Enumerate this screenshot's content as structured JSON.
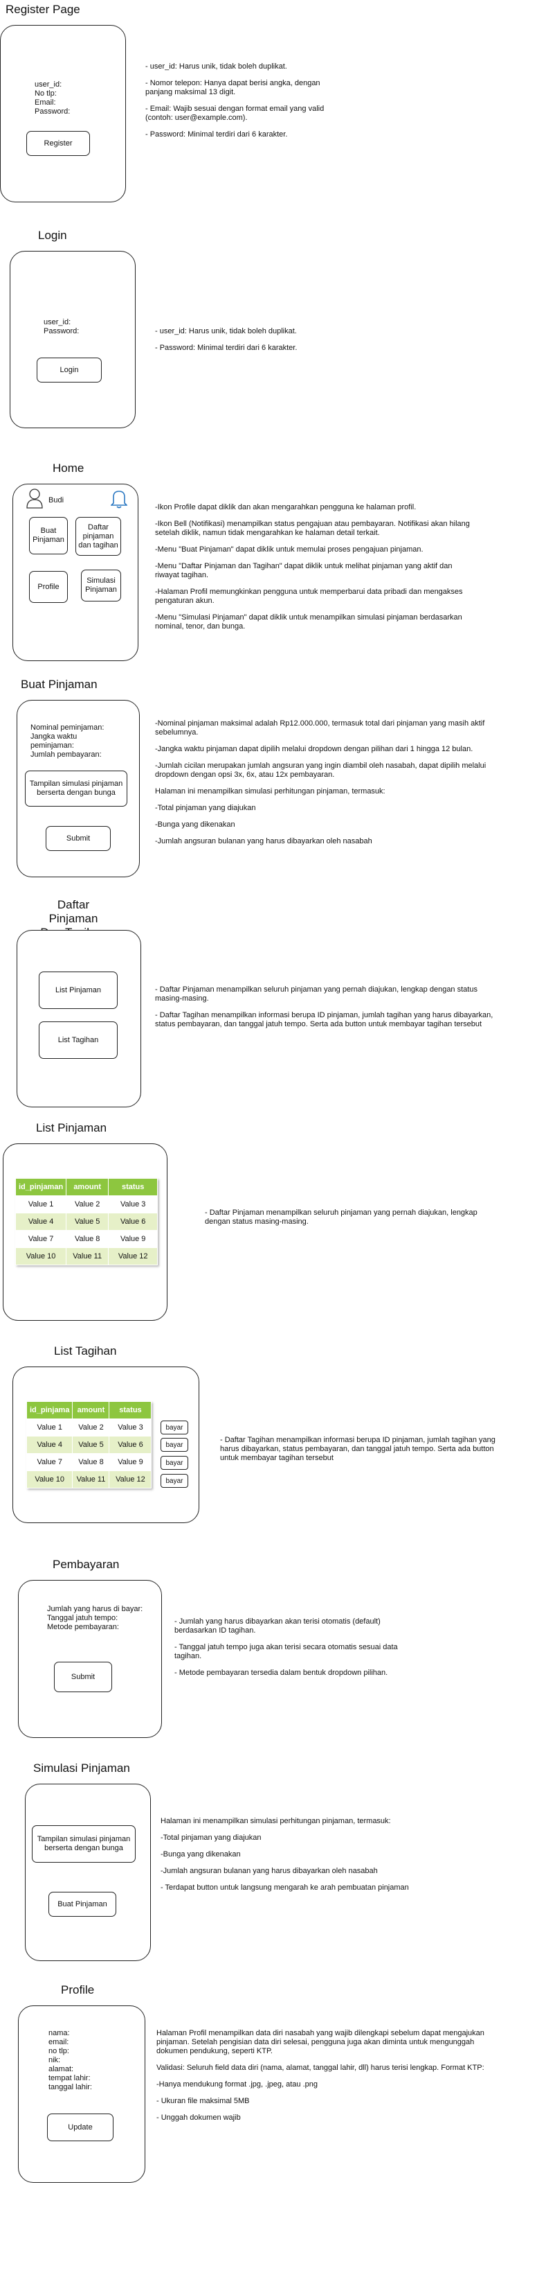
{
  "register": {
    "title": "Register Page",
    "fields": "user_id:\nNo tlp:\nEmail:\nPassword:",
    "button": "Register",
    "notes": [
      "- user_id: Harus unik, tidak boleh duplikat.",
      "- Nomor telepon: Hanya dapat berisi angka, dengan panjang maksimal 13 digit.",
      "- Email: Wajib sesuai dengan format email yang valid (contoh: user@example.com).",
      "- Password: Minimal terdiri dari 6 karakter."
    ]
  },
  "login": {
    "title": "Login",
    "fields": "user_id:\nPassword:",
    "button": "Login",
    "notes": [
      "- user_id: Harus unik, tidak boleh duplikat.",
      "- Password: Minimal terdiri dari 6 karakter."
    ]
  },
  "home": {
    "title": "Home",
    "username": "Budi",
    "buttons": [
      "Buat\nPinjaman",
      "Daftar\npinjaman\ndan tagihan",
      "Profile",
      "Simulasi\nPinjaman"
    ],
    "notes": [
      "-Ikon Profile dapat diklik dan akan mengarahkan pengguna ke halaman profil.",
      "-Ikon Bell (Notifikasi) menampilkan status pengajuan atau pembayaran. Notifikasi akan hilang setelah diklik, namun tidak mengarahkan ke halaman detail terkait.",
      "-Menu \"Buat Pinjaman\" dapat diklik untuk memulai proses pengajuan pinjaman.",
      "-Menu \"Daftar Pinjaman dan Tagihan\" dapat diklik untuk melihat pinjaman yang aktif dan riwayat tagihan.",
      "-Halaman Profil memungkinkan pengguna untuk memperbarui data pribadi dan mengakses pengaturan akun.",
      "-Menu \"Simulasi Pinjaman\" dapat diklik untuk menampilkan simulasi pinjaman berdasarkan nominal, tenor, dan bunga."
    ]
  },
  "buat": {
    "title": "Buat Pinjaman",
    "fields": "Nominal peminjaman:\nJangka waktu\npeminjaman:\nJumlah pembayaran:",
    "sim_box": "Tampilan simulasi pinjaman\nberserta dengan bunga",
    "button": "Submit",
    "notes": [
      "-Nominal pinjaman maksimal adalah Rp12.000.000, termasuk total dari pinjaman yang masih aktif sebelumnya.",
      "-Jangka waktu pinjaman dapat dipilih melalui dropdown dengan pilihan dari 1 hingga 12 bulan.",
      "-Jumlah cicilan merupakan jumlah angsuran yang ingin diambil oleh nasabah, dapat dipilih melalui dropdown dengan opsi 3x, 6x, atau 12x pembayaran.",
      "Halaman ini menampilkan simulasi perhitungan pinjaman, termasuk:",
      "-Total pinjaman yang diajukan",
      "-Bunga yang dikenakan",
      "-Jumlah angsuran bulanan yang harus dibayarkan oleh nasabah"
    ]
  },
  "daftar": {
    "title": "Daftar Pinjaman\nDan Tagihan",
    "buttons": [
      "List Pinjaman",
      "List Tagihan"
    ],
    "notes": [
      "- Daftar Pinjaman menampilkan seluruh pinjaman yang pernah diajukan, lengkap dengan status masing-masing.",
      "- Daftar Tagihan menampilkan informasi berupa ID pinjaman, jumlah tagihan yang harus dibayarkan, status pembayaran, dan tanggal jatuh tempo. Serta ada button untuk membayar tagihan tersebut"
    ]
  },
  "list_pinjaman": {
    "title": "List Pinjaman",
    "headers": [
      "id_pinjaman",
      "amount",
      "status"
    ],
    "rows": [
      [
        "Value 1",
        "Value 2",
        "Value 3"
      ],
      [
        "Value 4",
        "Value 5",
        "Value 6"
      ],
      [
        "Value 7",
        "Value 8",
        "Value 9"
      ],
      [
        "Value 10",
        "Value 11",
        "Value 12"
      ]
    ],
    "notes": [
      "- Daftar Pinjaman menampilkan seluruh pinjaman yang pernah diajukan, lengkap dengan status masing-masing."
    ]
  },
  "list_tagihan": {
    "title": "List Tagihan",
    "headers": [
      "id_pinjama",
      "amount",
      "status"
    ],
    "rows": [
      [
        "Value 1",
        "Value 2",
        "Value 3"
      ],
      [
        "Value 4",
        "Value 5",
        "Value 6"
      ],
      [
        "Value 7",
        "Value 8",
        "Value 9"
      ],
      [
        "Value 10",
        "Value 11",
        "Value 12"
      ]
    ],
    "pay_label": "bayar",
    "notes": [
      "- Daftar Tagihan menampilkan informasi berupa ID pinjaman, jumlah tagihan yang harus dibayarkan, status pembayaran, dan tanggal jatuh tempo. Serta ada button untuk membayar tagihan tersebut"
    ]
  },
  "pembayaran": {
    "title": "Pembayaran",
    "fields": "Jumlah yang harus di bayar:\nTanggal jatuh tempo:\nMetode pembayaran:",
    "button": "Submit",
    "notes": [
      "- Jumlah yang harus dibayarkan akan terisi otomatis (default) berdasarkan ID tagihan.",
      "- Tanggal jatuh tempo juga akan terisi secara otomatis sesuai data tagihan.",
      "- Metode pembayaran tersedia dalam bentuk dropdown pilihan."
    ]
  },
  "simulasi": {
    "title": "Simulasi Pinjaman",
    "sim_box": "Tampilan simulasi pinjaman\nberserta dengan bunga",
    "button": "Buat Pinjaman",
    "notes": [
      "Halaman ini menampilkan simulasi perhitungan pinjaman, termasuk:",
      "-Total pinjaman yang diajukan",
      "-Bunga yang dikenakan",
      "-Jumlah angsuran bulanan yang harus dibayarkan oleh nasabah",
      "- Terdapat button untuk langsung mengarah ke arah pembuatan pinjaman"
    ]
  },
  "profile": {
    "title": "Profile",
    "fields": "nama:\nemail:\nno tlp:\nnik:\nalamat:\ntempat lahir:\ntanggal lahir:",
    "button": "Update",
    "notes": [
      "Halaman Profil menampilkan data diri nasabah yang wajib dilengkapi sebelum dapat mengajukan pinjaman. Setelah pengisian data diri selesai, pengguna juga akan diminta untuk mengunggah dokumen pendukung, seperti KTP.",
      "Validasi: Seluruh field data diri (nama, alamat, tanggal lahir, dll) harus terisi lengkap. Format KTP:",
      "-Hanya mendukung format .jpg, .jpeg, atau .png",
      "- Ukuran file maksimal 5MB",
      "- Unggah dokumen wajib"
    ]
  }
}
